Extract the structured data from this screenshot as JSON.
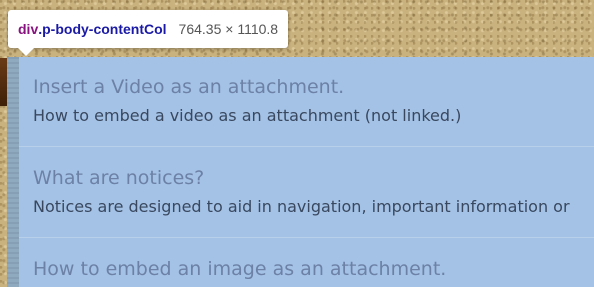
{
  "inspector": {
    "tag": "div",
    "class_name": ".p-body-contentCol",
    "dimensions": "764.35 × 1110.8"
  },
  "notices": [
    {
      "title": "Insert a Video as an attachment.",
      "description": "How to embed a video as an attachment (not linked.)"
    },
    {
      "title": "What are notices?",
      "description": "Notices are designed to aid in navigation, important information or"
    },
    {
      "title": "How to embed an image as an attachment."
    }
  ],
  "colors": {
    "highlight_overlay": "#a4c2e6",
    "title_text": "#6d81a6",
    "description_text": "#39485f"
  }
}
